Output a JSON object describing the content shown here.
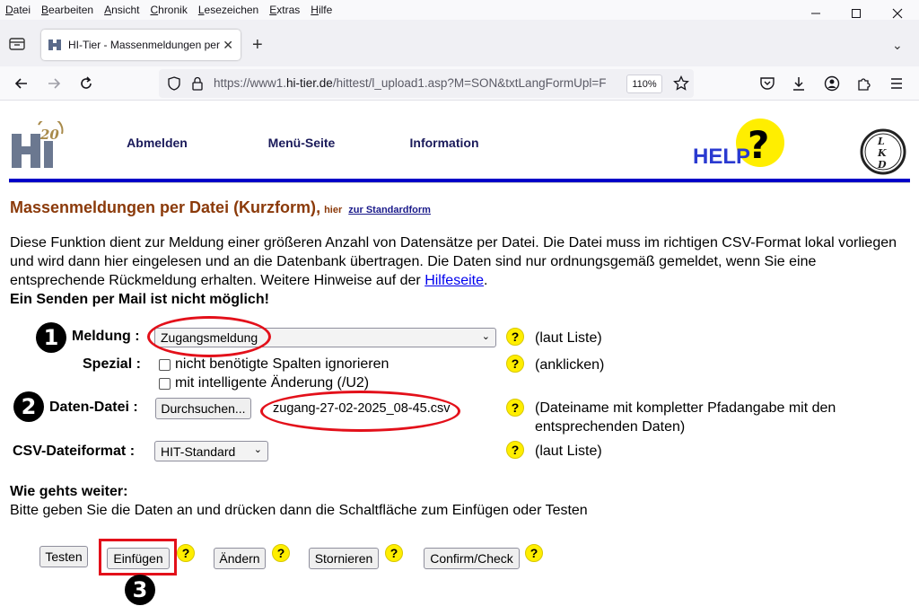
{
  "browser": {
    "menu": [
      "Datei",
      "Bearbeiten",
      "Ansicht",
      "Chronik",
      "Lesezeichen",
      "Extras",
      "Hilfe"
    ],
    "tab_title": "HI-Tier - Massenmeldungen per Datei",
    "url_prefix": "https://www1.",
    "url_host": "hi-tier.de",
    "url_path": "/hittest/l_upload1.asp?M=SON&txtLangFormUpl=F",
    "zoom": "110%"
  },
  "header": {
    "nav": [
      "Abmelden",
      "Menü-Seite",
      "Information"
    ],
    "help_text": "HELP",
    "lkd_letters": [
      "L",
      "K",
      "D"
    ],
    "hit_logo_text": "20"
  },
  "main": {
    "title": "Massenmeldungen per Datei (Kurzform)",
    "title_sep": ",",
    "hier": "hier",
    "std_link": "zur Standardform",
    "intro_text": "Diese Funktion dient zur Meldung einer größeren Anzahl von Datensätze per Datei. Die Datei muss im richtigen CSV-Format lokal vorliegen und wird dann hier eingelesen und an die Datenbank übertragen. Die Daten sind nur ordnungsgemäß gemeldet, wenn Sie eine entsprechende Rückmeldung erhalten. Weitere Hinweise auf der ",
    "intro_link": "Hilfeseite",
    "intro_end": ".",
    "no_mail": "Ein Senden per Mail ist nicht möglich!"
  },
  "form": {
    "meldung_label": "Meldung :",
    "meldung_value": "Zugangsmeldung",
    "meldung_hint": "(laut Liste)",
    "spezial_label": "Spezial :",
    "spezial_opt1": "nicht benötigte Spalten ignorieren",
    "spezial_opt2": "mit intelligente Änderung (/U2)",
    "spezial_hint": "(anklicken)",
    "datei_label": "Daten-Datei :",
    "browse_button": "Durchsuchen...",
    "file_name": "zugang-27-02-2025_08-45.csv",
    "datei_hint": "(Dateiname mit kompletter Pfadangabe mit den entsprechenden Daten)",
    "csv_label": "CSV-Dateiformat :",
    "csv_value": "HIT-Standard",
    "csv_hint": "(laut Liste)",
    "help_mark": "?"
  },
  "next": {
    "heading": "Wie gehts weiter:",
    "text": "Bitte geben Sie die Daten an und drücken dann die Schaltfläche zum Einfügen oder Testen"
  },
  "actions": [
    "Testen",
    "Einfügen",
    "Ändern",
    "Stornieren",
    "Confirm/Check"
  ],
  "markers": [
    "1",
    "2",
    "3"
  ],
  "colors": {
    "title": "#8b3a0a",
    "rule": "#0000c8",
    "annotation": "#e3101a",
    "help": "#ffee00"
  }
}
